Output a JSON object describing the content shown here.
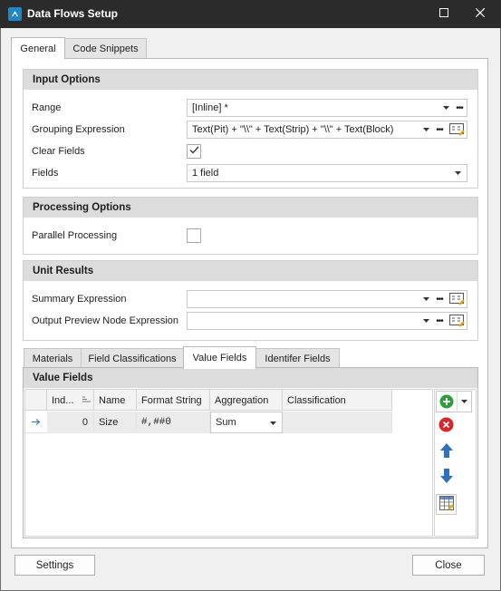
{
  "window": {
    "title": "Data Flows Setup"
  },
  "main_tabs": [
    {
      "label": "General"
    },
    {
      "label": "Code Snippets"
    }
  ],
  "input_options": {
    "header": "Input Options",
    "range_label": "Range",
    "range_value": "[Inline] *",
    "grouping_label": "Grouping Expression",
    "grouping_value": "Text(Pit) + \"\\\\\" + Text(Strip) + \"\\\\\" + Text(Block)",
    "clear_fields_label": "Clear Fields",
    "clear_fields_checked": true,
    "fields_label": "Fields",
    "fields_value": "1 field"
  },
  "processing_options": {
    "header": "Processing Options",
    "parallel_label": "Parallel Processing",
    "parallel_checked": false
  },
  "unit_results": {
    "header": "Unit Results",
    "summary_label": "Summary Expression",
    "summary_value": "",
    "output_preview_label": "Output Preview Node Expression",
    "output_preview_value": ""
  },
  "sub_tabs": [
    {
      "label": "Materials"
    },
    {
      "label": "Field Classifications"
    },
    {
      "label": "Value Fields"
    },
    {
      "label": "Identifer Fields"
    }
  ],
  "value_fields": {
    "header": "Value Fields",
    "columns": [
      "Ind...",
      "Name",
      "Format String",
      "Aggregation",
      "Classification"
    ],
    "rows": [
      {
        "index": "0",
        "name": "Size",
        "format": "#,##0",
        "aggregation": "Sum",
        "classification": ""
      }
    ]
  },
  "footer": {
    "settings_label": "Settings",
    "close_label": "Close"
  },
  "icons": {
    "add": "add-icon",
    "delete": "delete-icon",
    "move_up": "arrow-up-icon",
    "move_down": "arrow-down-icon",
    "table": "table-icon",
    "expression_editor": "expression-editor-icon"
  },
  "colors": {
    "titlebar": "#2b2b2b",
    "group_header": "#dcdcdc",
    "add_green": "#2e9e3c",
    "delete_red": "#d9262c",
    "arrow_blue": "#2f6fc2"
  }
}
